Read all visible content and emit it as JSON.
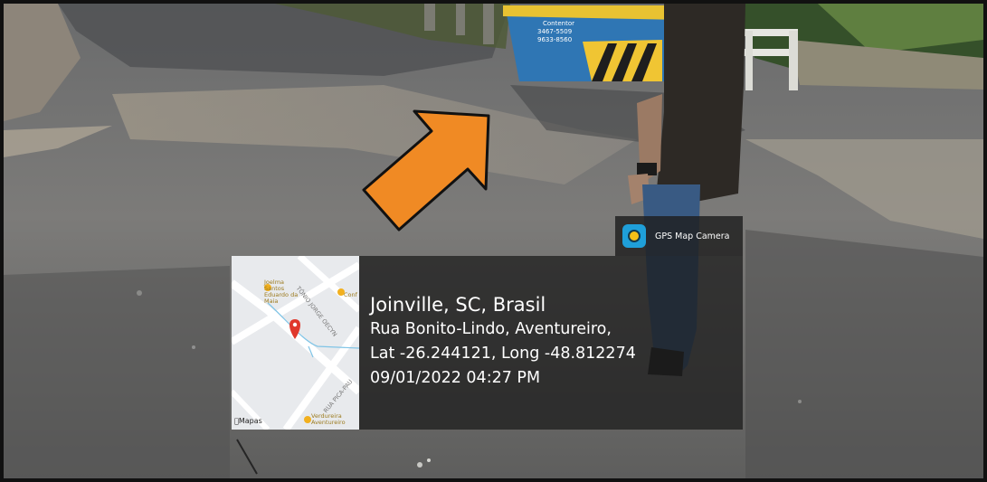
{
  "app_badge": {
    "name": "GPS Map Camera",
    "icon": "gps-camera-app-icon"
  },
  "location": {
    "title": "Joinville, SC, Brasil",
    "address": "Rua Bonito-Lindo, Aventureiro,",
    "coordinates": "Lat -26.244121, Long -48.812274",
    "datetime": "09/01/2022 04:27 PM"
  },
  "map": {
    "attribution": "Mapas",
    "place_top": "Joelma Santos Eduardo da Maia",
    "place_top_right": "Conf",
    "place_bottom": "Verdureira Aventureiro",
    "road_1": "TÔNIO JORGE OECYN",
    "road_2": "RUA PICA-PAU",
    "pin_icon": "location-pin-icon"
  },
  "container_sign": {
    "line1": "Contentor",
    "line2": "3467-5509",
    "line3": "9633-8560"
  },
  "annotation": {
    "arrow_color": "#f08a24",
    "icon": "arrow-annotation-icon"
  }
}
